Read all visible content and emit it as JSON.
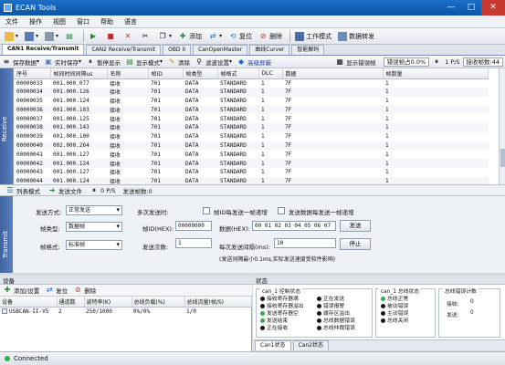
{
  "window": {
    "title": "ECAN Tools",
    "controls": [
      "—",
      "□",
      "✕"
    ]
  },
  "menu": [
    "文件",
    "操作",
    "视图",
    "窗口",
    "帮助",
    "语言"
  ],
  "toolbar": {
    "add": "添加",
    "reset": "复位",
    "delete": "删除",
    "work_mode": "工作模式",
    "data_forward": "数据转发"
  },
  "tabs": [
    "CAN1 Receive/Transmit",
    "CAN2 Receive/Transmit",
    "OBD II",
    "CanOpenMaster",
    "曲线Curver",
    "智能解码"
  ],
  "recv_toolbar": {
    "save_data": "保存数据",
    "realtime_save": "实时保存",
    "pause_display": "暂停显示",
    "display_mode": "显示模式",
    "clear": "清除",
    "filter_settings": "滤波设置",
    "advanced_screen": "高级屏蔽",
    "show_error_frames": "显示错误帧",
    "error_rate": "错误帧占0.0%",
    "fps_value": "1",
    "fps_unit": "P/S",
    "recv_count": "接收帧数:44"
  },
  "recv_label": "Receive",
  "grid": {
    "columns": [
      "序号",
      "帧间时间间隔us",
      "名称",
      "帧ID",
      "帧类型",
      "帧格式",
      "DLC",
      "数据",
      "帧数量"
    ],
    "rows": [
      [
        "00000033",
        "001.000.077",
        "接收",
        "701",
        "DATA",
        "STANDARD",
        "1",
        "7F",
        "1"
      ],
      [
        "00000034",
        "001.000.126",
        "接收",
        "701",
        "DATA",
        "STANDARD",
        "1",
        "7F",
        "1"
      ],
      [
        "00000035",
        "001.000.124",
        "接收",
        "701",
        "DATA",
        "STANDARD",
        "1",
        "7F",
        "1"
      ],
      [
        "00000036",
        "001.000.103",
        "接收",
        "701",
        "DATA",
        "STANDARD",
        "1",
        "7F",
        "1"
      ],
      [
        "00000037",
        "001.000.125",
        "接收",
        "701",
        "DATA",
        "STANDARD",
        "1",
        "7F",
        "1"
      ],
      [
        "00000038",
        "001.000.143",
        "接收",
        "701",
        "DATA",
        "STANDARD",
        "1",
        "7F",
        "1"
      ],
      [
        "00000039",
        "001.000.100",
        "接收",
        "701",
        "DATA",
        "STANDARD",
        "1",
        "7F",
        "1"
      ],
      [
        "00000040",
        "002.000.264",
        "接收",
        "701",
        "DATA",
        "STANDARD",
        "1",
        "7F",
        "1"
      ],
      [
        "00000041",
        "001.000.127",
        "接收",
        "701",
        "DATA",
        "STANDARD",
        "1",
        "7F",
        "1"
      ],
      [
        "00000042",
        "001.000.124",
        "接收",
        "701",
        "DATA",
        "STANDARD",
        "1",
        "7F",
        "1"
      ],
      [
        "00000043",
        "001.000.127",
        "接收",
        "701",
        "DATA",
        "STANDARD",
        "1",
        "7F",
        "1"
      ],
      [
        "00000044",
        "001.000.124",
        "接收",
        "701",
        "DATA",
        "STANDARD",
        "1",
        "7F",
        "1"
      ]
    ]
  },
  "mode_bar": {
    "list_mode": "列表模式",
    "send_file": "发送文件",
    "rate": "0 P/S",
    "send_count": "发送帧数:0"
  },
  "transmit": {
    "side_label": "Transmit",
    "send_mode_label": "发送方式:",
    "send_mode_value": "正常发送",
    "frame_type_label": "帧类型:",
    "frame_type_value": "数据帧",
    "frame_format_label": "帧格式:",
    "frame_format_value": "标准帧",
    "multi_send_label": "多次发送时:",
    "id_increment": "帧ID每发送一帧递增",
    "data_increment": "发送数据每发送一帧递增",
    "frame_id_label": "帧ID(HEX):",
    "frame_id_value": "00000000",
    "data_label": "数据(HEX):",
    "data_value": "00 01 02 03 04 05 06 07",
    "send_button": "发送",
    "send_times_label": "发送次数:",
    "send_times_value": "1",
    "interval_label": "每次发送间隔(ms):",
    "interval_value": "10",
    "stop_button": "停止",
    "note": "(发送间隔最小0.1ms,实际发送速度受软件影响)"
  },
  "devices": {
    "pane_title": "设备",
    "add_settings": "添加/设置",
    "reset": "复位",
    "delete": "删除",
    "columns": [
      "设备",
      "通道数",
      "波特率(K)",
      "总线负载(%)",
      "总线流量(帧/S)"
    ],
    "rows": [
      [
        "USBCAN-II-V5",
        "2",
        "250/1000",
        "0%/0%",
        "1/0"
      ]
    ]
  },
  "status": {
    "pane_title": "状态",
    "group1_title": "can_1 控制状态",
    "group1_col1": [
      "接收寄存器满",
      "接收寄存器溢出",
      "发送寄存器空",
      "发送结束",
      "正在接收"
    ],
    "group1_col2": [
      "正在发送",
      "错误报警",
      "缓存区溢出",
      "总线数据错误",
      "总线仲裁错误"
    ],
    "group2_title": "can_1 总线状态",
    "group2_items": [
      "总线正常",
      "被动错误",
      "主动错误",
      "总线关闭"
    ],
    "group3_title": "总线错误计数",
    "recv_label": "接收:",
    "recv_value": "0",
    "send_label": "发送:",
    "send_value": "0",
    "tabs": [
      "Can1状态",
      "Can2状态"
    ]
  },
  "statusbar": {
    "text": "Connected"
  },
  "colors": {
    "accent": "#1b6fc7",
    "ok_green": "#2bb24c",
    "side_blue": "#4a6fb0"
  }
}
